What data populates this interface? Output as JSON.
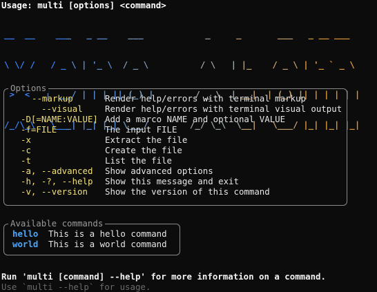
{
  "usage": "Usage: multi [options] <command>",
  "banner": {
    "lines": [
      "__  __    ___   _ __    ___            _     _       ___   _ __ ___",
      "\\ \\/ /   / _ \\ | '_ \\  / _ \\          / \\   | |_    / _ \\ | '_ ` _ \\",
      " >  <   |  __/ | | | || (_) |        / _ \\  | __|  | (_) || | | | | |",
      "/_/\\_\\   \\___| |_| |_| \\___/        /_/ \\_\\  \\__|   \\___/ |_| |_| |_|"
    ],
    "colors": [
      "#3b82f6",
      "#5b8fd6",
      "#7a9cc0",
      "#9aa8a6",
      "#c4a070",
      "#e09a3a"
    ]
  },
  "options": {
    "title": "Options",
    "items": [
      {
        "name": "--markup",
        "desc": "Render help/errors with terminal markup"
      },
      {
        "name": "--visual",
        "desc": "Render help/errors with terminal visual output"
      },
      {
        "name": "-D[=NAME:VALUE]",
        "desc": "Add a marco NAME and optional VALUE"
      },
      {
        "name": "-f=FILE",
        "desc": "The input FILE"
      },
      {
        "name": "-x",
        "desc": "Extract the file"
      },
      {
        "name": "-c",
        "desc": "Create the file"
      },
      {
        "name": "-t",
        "desc": "List the file"
      },
      {
        "name": "-a, --advanced",
        "desc": "Show advanced options"
      },
      {
        "name": "-h, -?, --help",
        "desc": "Show this message and exit"
      },
      {
        "name": "-v, --version",
        "desc": "Show the version of this command"
      }
    ]
  },
  "commands": {
    "title": "Available commands",
    "items": [
      {
        "name": "hello",
        "desc": "This is a hello command"
      },
      {
        "name": "world",
        "desc": "This is a world command"
      }
    ]
  },
  "footer": {
    "run": "Run 'multi [command] --help' for more information on a command.",
    "hint": "Use `multi --help` for usage."
  }
}
